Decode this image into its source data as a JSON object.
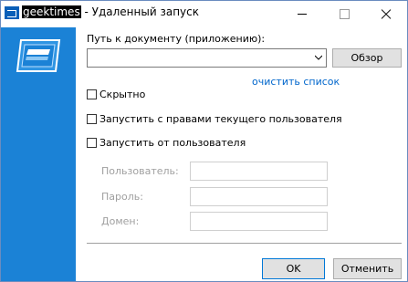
{
  "titlebar": {
    "app_name": "geektimes",
    "title_rest": " - Удаленный запуск"
  },
  "form": {
    "path_label": "Путь к документу (приложению):",
    "path_value": "",
    "browse_label": "Обзор",
    "clear_list_label": "очистить список",
    "options": [
      {
        "label": "Скрытно",
        "checked": false
      },
      {
        "label": "Запустить с правами текущего пользователя",
        "checked": false
      },
      {
        "label": "Запустить от пользователя",
        "checked": false
      }
    ],
    "credentials": {
      "user_label": "Пользователь:",
      "password_label": "Пароль:",
      "domain_label": "Домен:"
    }
  },
  "buttons": {
    "ok_label": "OK",
    "cancel_label": "Отменить"
  },
  "colors": {
    "accent": "#1b82d6",
    "link": "#0066cc"
  }
}
